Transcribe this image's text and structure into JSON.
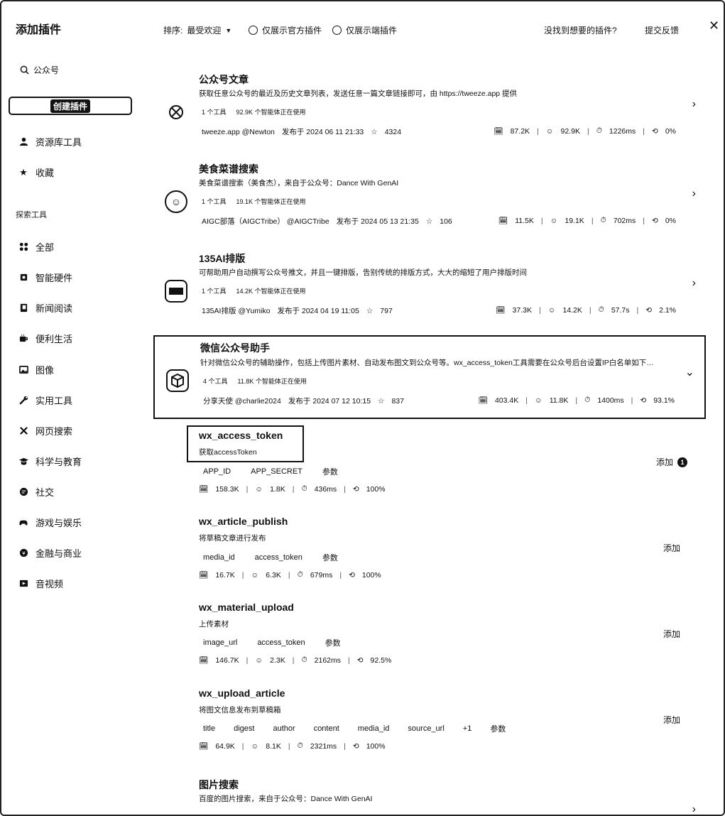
{
  "app_title": "添加插件",
  "search": {
    "label": "公众号"
  },
  "create_button": "创建插件",
  "sidebar": {
    "top_items": [
      {
        "label": "资源库工具",
        "icon": "user-icon"
      },
      {
        "label": "收藏",
        "icon": "star-icon"
      }
    ],
    "section_title": "探索工具",
    "categories": [
      {
        "label": "全部",
        "icon": "grid-icon"
      },
      {
        "label": "智能硬件",
        "icon": "chip-icon"
      },
      {
        "label": "新闻阅读",
        "icon": "book-icon"
      },
      {
        "label": "便利生活",
        "icon": "coffee-icon"
      },
      {
        "label": "图像",
        "icon": "image-icon"
      },
      {
        "label": "实用工具",
        "icon": "wrench-icon"
      },
      {
        "label": "网页搜索",
        "icon": "cross-icon"
      },
      {
        "label": "科学与教育",
        "icon": "graduation-icon"
      },
      {
        "label": "社交",
        "icon": "chat-icon"
      },
      {
        "label": "游戏与娱乐",
        "icon": "gamepad-icon"
      },
      {
        "label": "金融与商业",
        "icon": "money-icon"
      },
      {
        "label": "音视频",
        "icon": "video-icon"
      }
    ]
  },
  "header": {
    "sort_label": "排序:",
    "sort_value": "最受欢迎",
    "filter_official": "仅展示官方插件",
    "filter_local": "仅展示端插件",
    "not_found": "没找到想要的插件?",
    "feedback": "提交反馈"
  },
  "plugins": [
    {
      "name": "公众号文章",
      "desc": "获取任意公众号的最近及历史文章列表，发送任意一篇文章链接即可，由 https://tweeze.app 提供",
      "tools": "1 个工具",
      "agents": "92.9K 个智能体正在使用",
      "author": "tweeze.app @Newton",
      "published": "发布于 2024 06 11 21:33",
      "stars": "4324",
      "stat1": "87.2K",
      "stat2": "92.9K",
      "stat3": "1226ms",
      "stat4": "0%"
    },
    {
      "name": "美食菜谱搜索",
      "desc": "美食菜谱搜索（美食杰），来自于公众号：Dance With GenAI",
      "tools": "1 个工具",
      "agents": "19.1K 个智能体正在使用",
      "author": "AIGC部落（AIGCTribe） @AIGCTribe",
      "published": "发布于 2024 05 13 21:35",
      "stars": "106",
      "stat1": "11.5K",
      "stat2": "19.1K",
      "stat3": "702ms",
      "stat4": "0%"
    },
    {
      "name": "135AI排版",
      "desc": "可帮助用户自动撰写公众号推文，并且一键排版，告别传统的排版方式，大大的缩短了用户排版时间",
      "tools": "1 个工具",
      "agents": "14.2K 个智能体正在使用",
      "author": "135AI排版 @Yumiko",
      "published": "发布于 2024 04 19 11:05",
      "stars": "797",
      "stat1": "37.3K",
      "stat2": "14.2K",
      "stat3": "57.7s",
      "stat4": "2.1%"
    },
    {
      "name": "微信公众号助手",
      "desc": "针对微信公众号的辅助操作，包括上传图片素材、自动发布图文到公众号等。wx_access_token工具需要在公众号后台设置IP白名单如下…",
      "tools": "4 个工具",
      "agents": "11.8K 个智能体正在使用",
      "author": "分享天使 @charlie2024",
      "published": "发布于 2024 07 12 10:15",
      "stars": "837",
      "stat1": "403.4K",
      "stat2": "11.8K",
      "stat3": "1400ms",
      "stat4": "93.1%"
    },
    {
      "name": "图片搜索",
      "desc": "百度的图片搜索，来自于公众号：Dance With GenAI"
    }
  ],
  "tools": [
    {
      "name": "wx_access_token",
      "desc": "获取accessToken",
      "params": [
        "APP_ID",
        "APP_SECRET",
        "参数"
      ],
      "stat1": "158.3K",
      "stat2": "1.8K",
      "stat3": "436ms",
      "stat4": "100%",
      "add": "添加",
      "badge": "1"
    },
    {
      "name": "wx_article_publish",
      "desc": "将草稿文章进行发布",
      "params": [
        "media_id",
        "access_token",
        "参数"
      ],
      "stat1": "16.7K",
      "stat2": "6.3K",
      "stat3": "679ms",
      "stat4": "100%",
      "add": "添加"
    },
    {
      "name": "wx_material_upload",
      "desc": "上传素材",
      "params": [
        "image_url",
        "access_token",
        "参数"
      ],
      "stat1": "146.7K",
      "stat2": "2.3K",
      "stat3": "2162ms",
      "stat4": "92.5%",
      "add": "添加"
    },
    {
      "name": "wx_upload_article",
      "desc": "将图文信息发布到草稿箱",
      "params": [
        "title",
        "digest",
        "author",
        "content",
        "media_id",
        "source_url",
        "+1",
        "参数"
      ],
      "stat1": "64.9K",
      "stat2": "8.1K",
      "stat3": "2321ms",
      "stat4": "100%",
      "add": "添加"
    }
  ]
}
